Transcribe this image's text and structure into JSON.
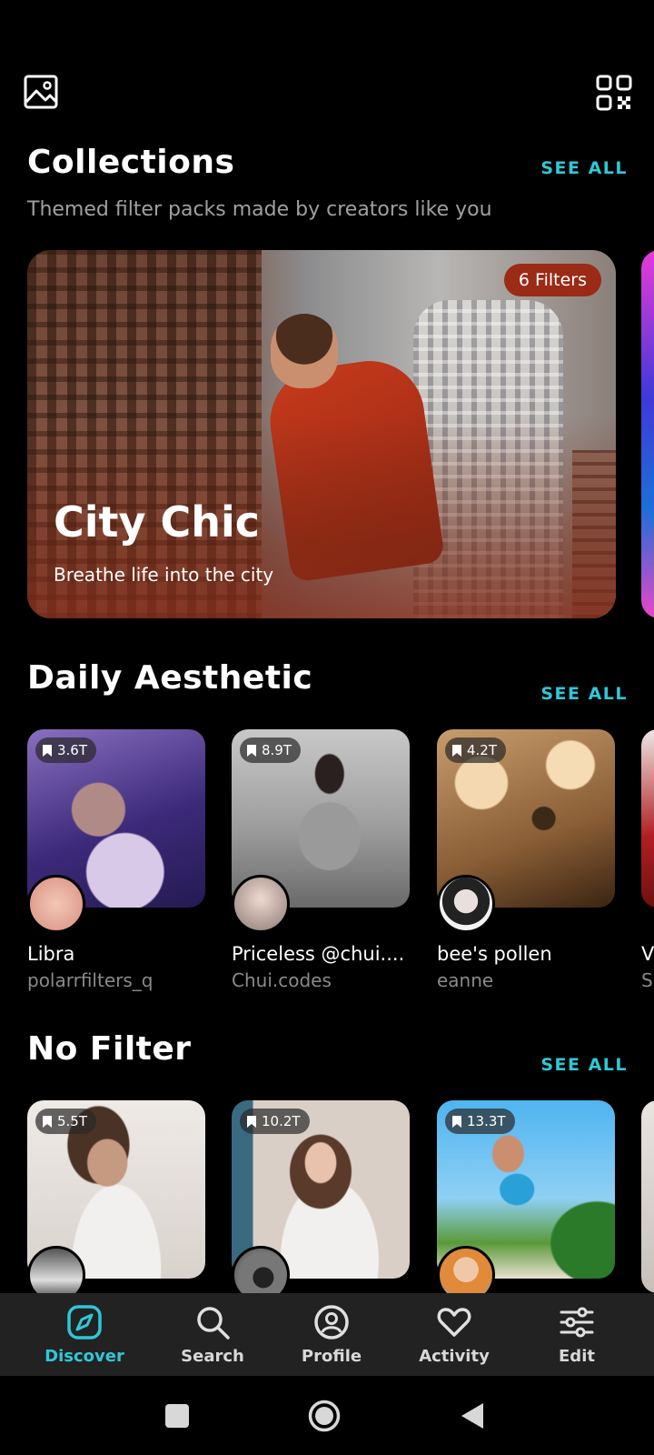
{
  "collections": {
    "title": "Collections",
    "see_all": "SEE ALL",
    "subtitle": "Themed filter packs made by creators like you",
    "hero": {
      "badge": "6 Filters",
      "title": "City Chic",
      "subtitle": "Breathe life into the city"
    }
  },
  "daily": {
    "title": "Daily Aesthetic",
    "see_all": "SEE ALL",
    "cards": [
      {
        "count": "3.6T",
        "name": "Libra",
        "author": "polarrfilters_q"
      },
      {
        "count": "8.9T",
        "name": "Priceless @chui....",
        "author": "Chui.codes"
      },
      {
        "count": "4.2T",
        "name": "bee's pollen",
        "author": "eanne"
      }
    ],
    "peek_name": "V",
    "peek_author": "S"
  },
  "nofilter": {
    "title": "No Filter",
    "see_all": "SEE ALL",
    "cards": [
      {
        "count": "5.5T"
      },
      {
        "count": "10.2T"
      },
      {
        "count": "13.3T"
      }
    ]
  },
  "nav": {
    "items": [
      {
        "label": "Discover",
        "icon": "compass-icon",
        "active": true
      },
      {
        "label": "Search",
        "icon": "search-icon"
      },
      {
        "label": "Profile",
        "icon": "profile-icon"
      },
      {
        "label": "Activity",
        "icon": "heart-icon"
      },
      {
        "label": "Edit",
        "icon": "sliders-icon"
      }
    ]
  },
  "colors": {
    "accent": "#2ec8d8",
    "badge": "#9b2a16",
    "nav_bg": "#222222"
  }
}
